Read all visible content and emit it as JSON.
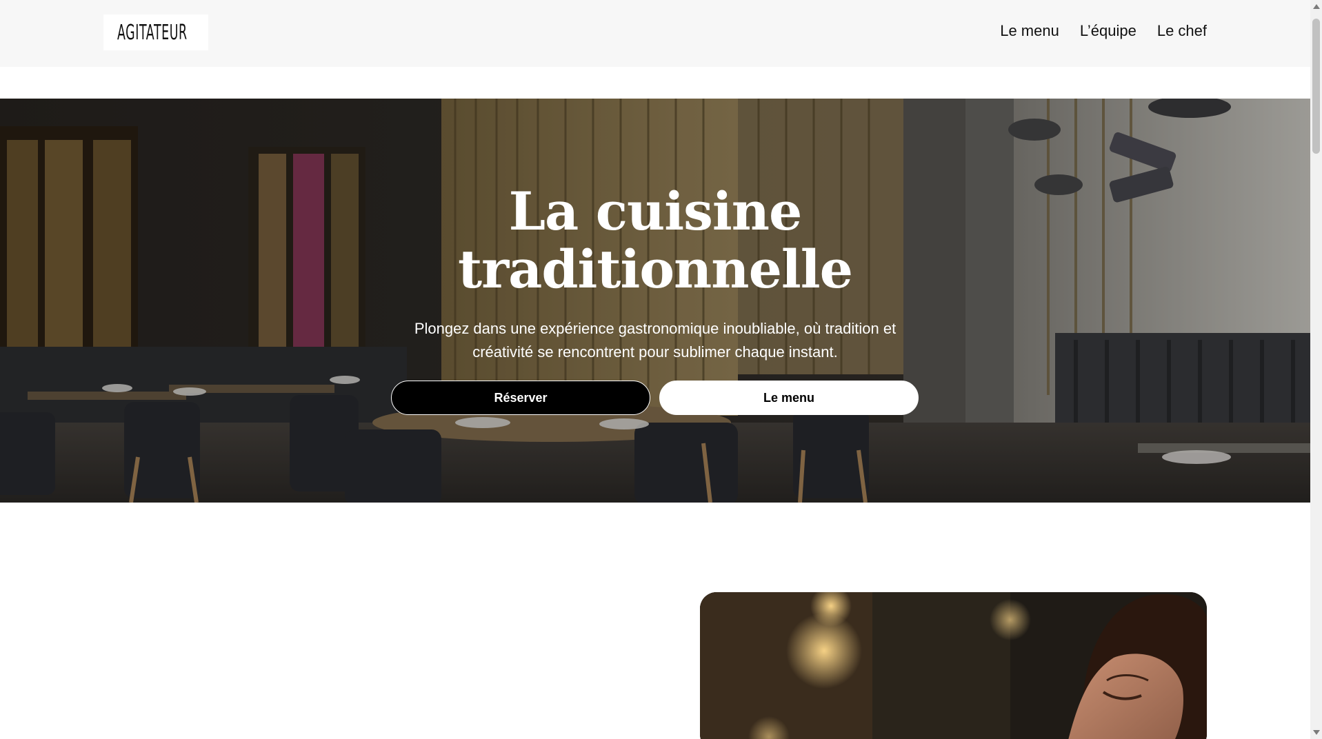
{
  "header": {
    "logo_text": "AGITATEUR",
    "logo_icon": "chef-hat-icon",
    "nav": [
      {
        "label": "Le menu"
      },
      {
        "label": "L’équipe"
      },
      {
        "label": "Le chef"
      }
    ]
  },
  "hero": {
    "title_line1": "La cuisine",
    "title_line2": "traditionnelle",
    "subtitle": "Plongez dans une expérience gastronomique inoubliable, où tradition et créativité se rencontrent pour sublimer chaque instant.",
    "primary_button": "Réserver",
    "secondary_button": "Le menu"
  },
  "colors": {
    "header_bg": "#f7f7f7",
    "primary_button_bg": "#000000",
    "secondary_button_bg": "#ffffff",
    "hero_text": "#ffffff"
  }
}
